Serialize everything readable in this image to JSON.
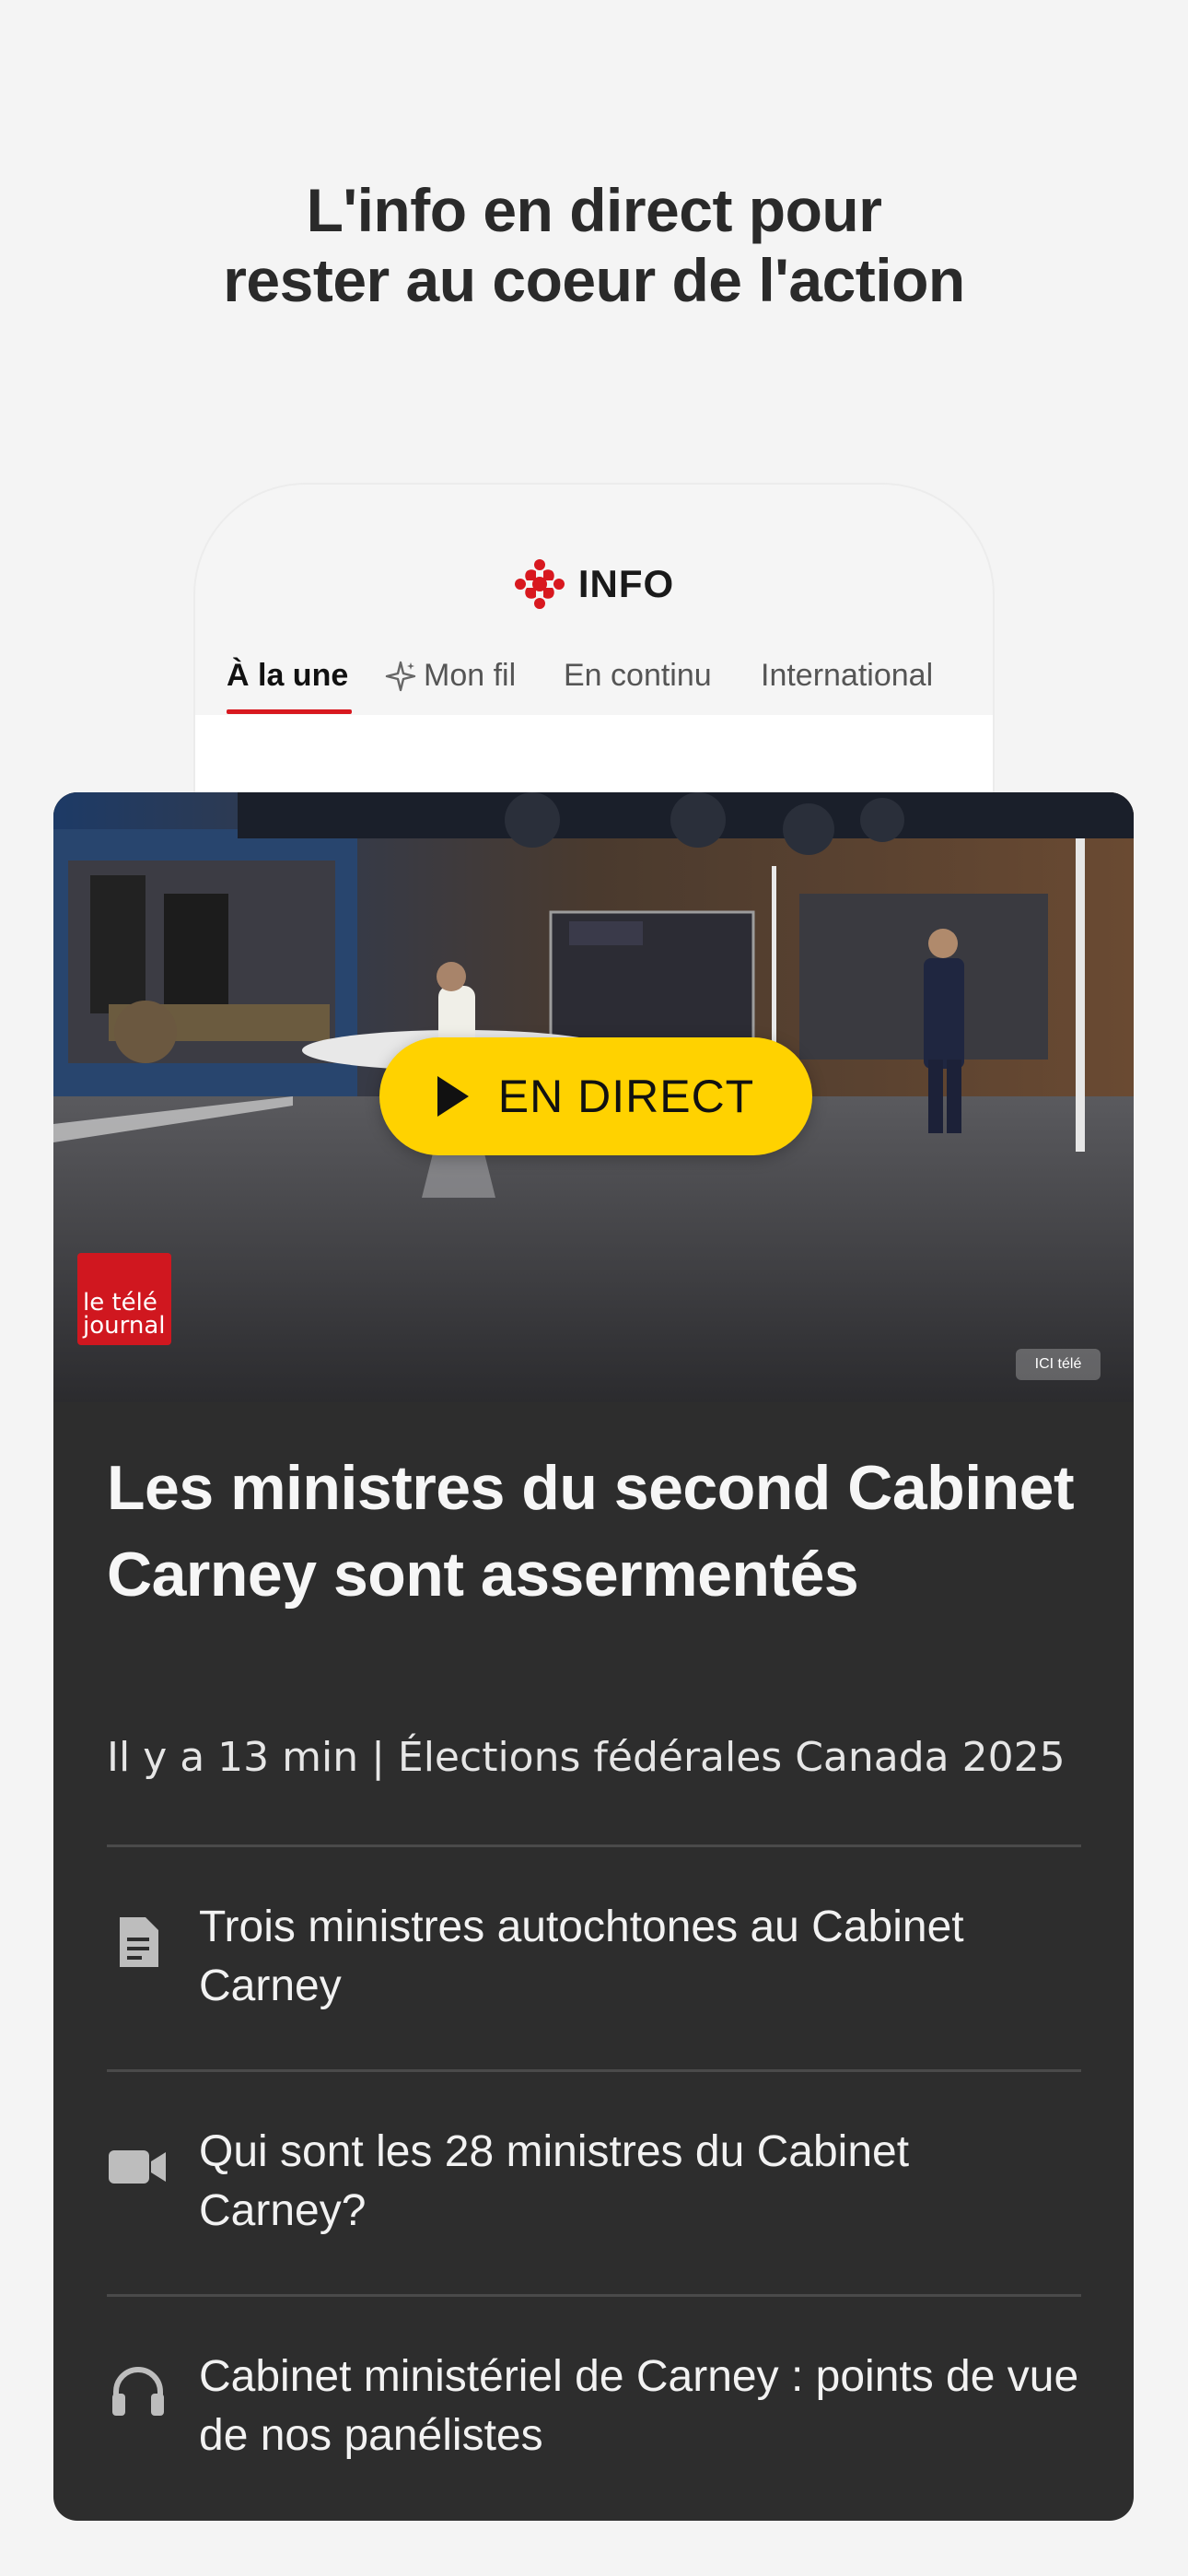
{
  "promo": {
    "headline_line1": "L'info en direct pour",
    "headline_line2": "rester au coeur de l'action"
  },
  "app": {
    "brand_name": "INFO",
    "logo_icon": "radio-canada-gem-icon",
    "tabs": [
      {
        "label": "À la une",
        "active": true
      },
      {
        "label": "Mon fil",
        "icon": "sparkle-icon"
      },
      {
        "label": "En continu"
      },
      {
        "label": "International"
      }
    ]
  },
  "live_card": {
    "live_label": "EN DIRECT",
    "show_logo_text_line1": "le télé",
    "show_logo_text_line2": "journal",
    "channel_badge": "ICI télé",
    "title": "Les ministres du second Cabinet Carney sont assermentés",
    "meta": "Il y a 13 min | Élections fédérales Canada 2025",
    "related": [
      {
        "icon": "article-icon",
        "text": "Trois ministres autochtones au Cabinet Carney"
      },
      {
        "icon": "video-icon",
        "text": "Qui sont les 28 ministres du Cabinet Carney?"
      },
      {
        "icon": "headphones-icon",
        "text": "Cabinet ministériel de Carney : points de vue de nos panélistes"
      }
    ]
  },
  "colors": {
    "accent_red": "#d8181f",
    "live_yellow": "#ffd200",
    "card_bg": "#2d2d2d",
    "page_bg": "#f4f4f4"
  }
}
